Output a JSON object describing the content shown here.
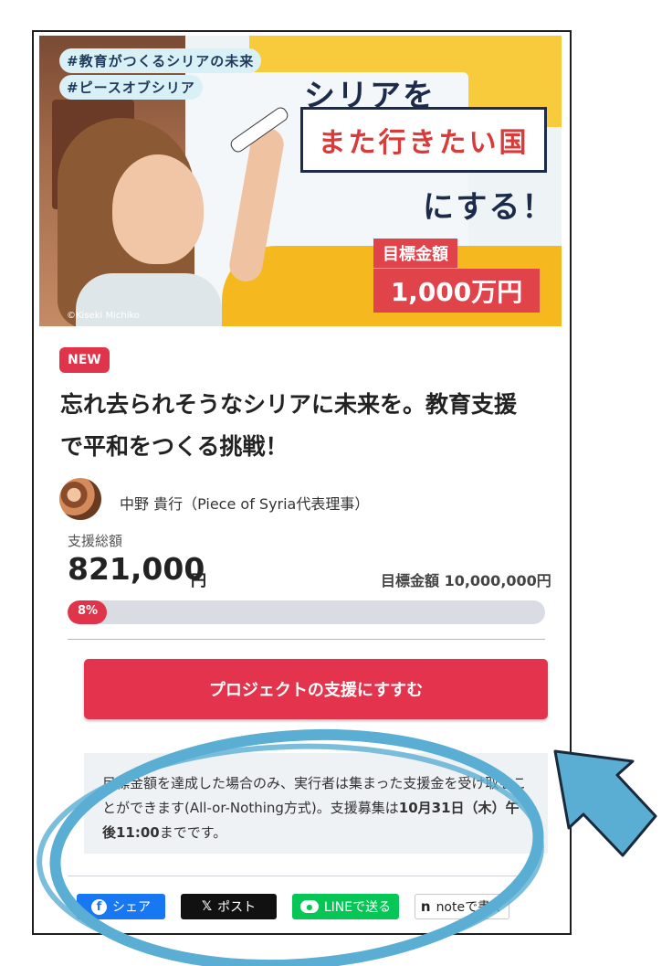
{
  "banner": {
    "hashtags": [
      "#教育がつくるシリアの未来",
      "#ピースオブシリア"
    ],
    "headline_top": "シリアを",
    "headline_box": "また行きたい国",
    "headline_bottom": "にする！",
    "goal_label": "目標金額",
    "goal_amount": "1,000万円",
    "credit": "©Kiseki Michiko"
  },
  "project": {
    "badge": "NEW",
    "title": "忘れ去られそうなシリアに未来を。教育支援で平和をつくる挑戦！",
    "author": "中野 貴行（Piece of Syria代表理事）",
    "raised_label": "支援総額",
    "raised_amount": "821,000",
    "raised_unit": "円",
    "goal_text": "目標金額 10,000,000円",
    "progress_fraction": 0.082,
    "progress_label": "8%",
    "support_button": "プロジェクトの支援にすすむ",
    "notice_text": "目標金額を達成した場合のみ、実行者は集まった支援金を受け取ることができます(All-or-Nothing方式)。支援募集は",
    "notice_deadline": "10月31日（木）午後11:00",
    "notice_tail": "までです。"
  },
  "share": {
    "facebook": "シェア",
    "x": "ポスト",
    "line": "LINEで送る",
    "note": "noteで書く"
  },
  "icons": {
    "facebook": "facebook-icon",
    "x": "x-logo-icon",
    "line": "line-icon",
    "note": "note-icon"
  },
  "colors": {
    "accent": "#e4344d",
    "annotation": "#5aaed3"
  }
}
